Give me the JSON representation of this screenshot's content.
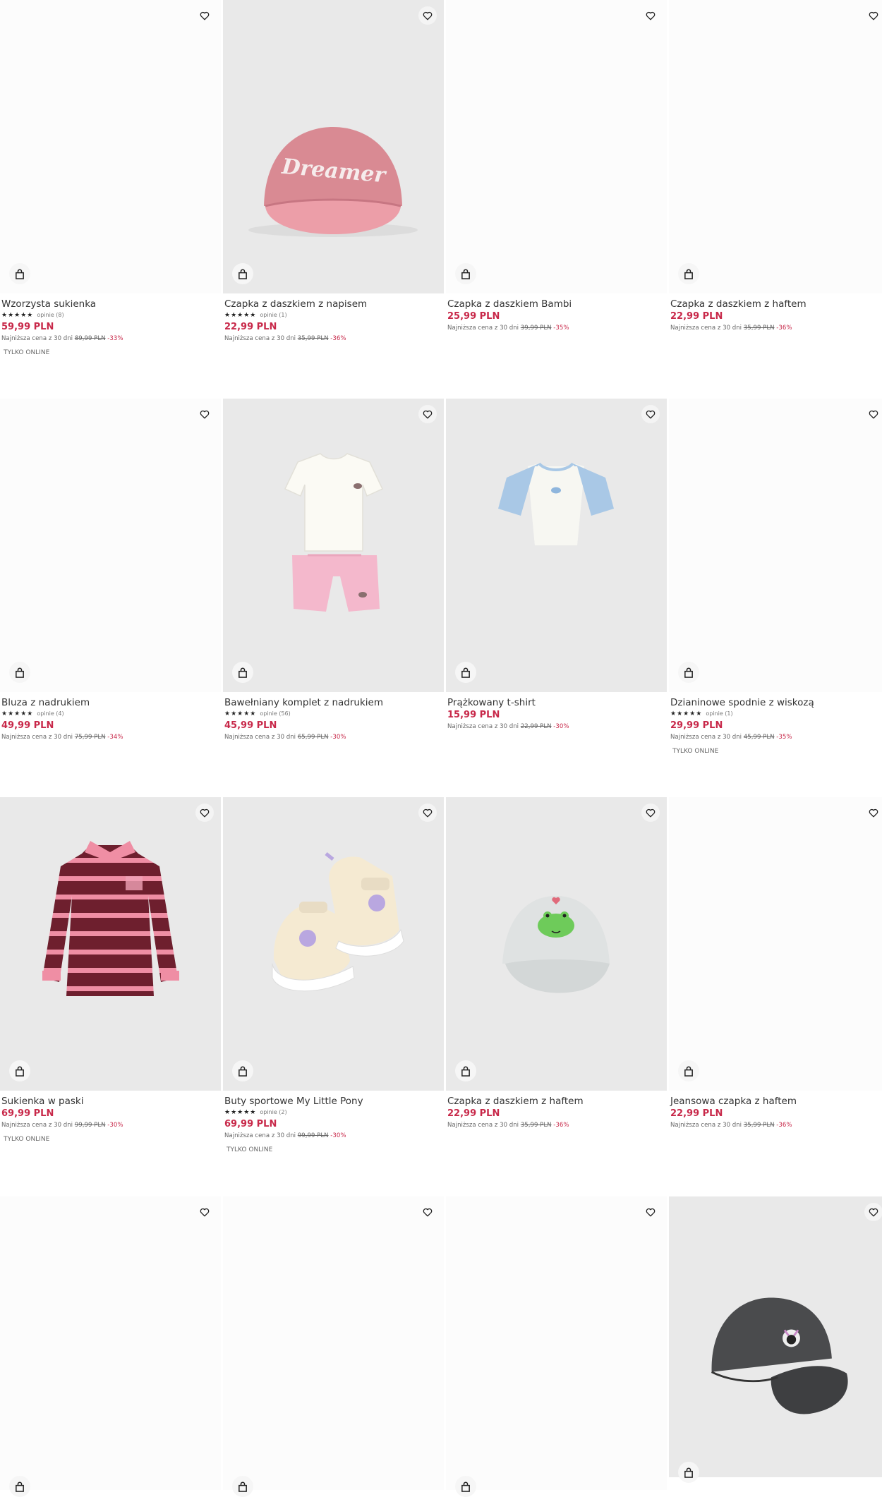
{
  "labels": {
    "lowest_prefix": "Najniższa cena z 30 dni",
    "online_only": "TYLKO ONLINE",
    "stars": "★★★★★"
  },
  "products": [
    {
      "name": "Wzorzysta sukienka",
      "reviews": "opinie (8)",
      "price": "59,99 PLN",
      "old_price": "89,99 PLN",
      "discount": "-33%",
      "online": true,
      "image": "none"
    },
    {
      "name": "Czapka z daszkiem z napisem",
      "reviews": "opinie (1)",
      "price": "22,99 PLN",
      "old_price": "35,99 PLN",
      "discount": "-36%",
      "online": false,
      "image": "pink-cap-icon"
    },
    {
      "name": "Czapka z daszkiem Bambi",
      "reviews": "",
      "price": "25,99 PLN",
      "old_price": "39,99 PLN",
      "discount": "-35%",
      "online": false,
      "image": "none"
    },
    {
      "name": "Czapka z daszkiem z haftem",
      "reviews": "",
      "price": "22,99 PLN",
      "old_price": "35,99 PLN",
      "discount": "-36%",
      "online": false,
      "image": "none"
    },
    {
      "name": "Bluza z nadrukiem",
      "reviews": "opinie (4)",
      "price": "49,99 PLN",
      "old_price": "75,99 PLN",
      "discount": "-34%",
      "online": false,
      "image": "none"
    },
    {
      "name": "Bawełniany komplet z nadrukiem",
      "reviews": "opinie (56)",
      "price": "45,99 PLN",
      "old_price": "65,99 PLN",
      "discount": "-30%",
      "online": false,
      "image": "tshirt-shorts-set-icon"
    },
    {
      "name": "Prążkowany t-shirt",
      "reviews": "",
      "price": "15,99 PLN",
      "old_price": "22,99 PLN",
      "discount": "-30%",
      "online": false,
      "image": "raglan-tshirt-icon"
    },
    {
      "name": "Dzianinowe spodnie z wiskozą",
      "reviews": "opinie (1)",
      "price": "29,99 PLN",
      "old_price": "45,99 PLN",
      "discount": "-35%",
      "online": true,
      "image": "none"
    },
    {
      "name": "Sukienka w paski",
      "reviews": "",
      "price": "69,99 PLN",
      "old_price": "99,99 PLN",
      "discount": "-30%",
      "online": true,
      "image": "striped-dress-icon"
    },
    {
      "name": "Buty sportowe My Little Pony",
      "reviews": "opinie (2)",
      "price": "69,99 PLN",
      "old_price": "99,99 PLN",
      "discount": "-30%",
      "online": true,
      "image": "sneakers-icon"
    },
    {
      "name": "Czapka z daszkiem z haftem",
      "reviews": "",
      "price": "22,99 PLN",
      "old_price": "35,99 PLN",
      "discount": "-36%",
      "online": false,
      "image": "frog-cap-icon"
    },
    {
      "name": "Jeansowa czapka z haftem",
      "reviews": "",
      "price": "22,99 PLN",
      "old_price": "35,99 PLN",
      "discount": "-36%",
      "online": false,
      "image": "none"
    },
    {
      "name": "",
      "reviews": "",
      "price": "",
      "old_price": "",
      "discount": "",
      "online": false,
      "image": "none"
    },
    {
      "name": "",
      "reviews": "",
      "price": "",
      "old_price": "",
      "discount": "",
      "online": false,
      "image": "none"
    },
    {
      "name": "",
      "reviews": "",
      "price": "",
      "old_price": "",
      "discount": "",
      "online": false,
      "image": "none"
    },
    {
      "name": "",
      "reviews": "",
      "price": "",
      "old_price": "",
      "discount": "",
      "online": false,
      "image": "dark-cap-icon"
    }
  ],
  "colors": {
    "price": "#c8294a",
    "image_bg": "#e9e9e9",
    "text": "#333333"
  }
}
